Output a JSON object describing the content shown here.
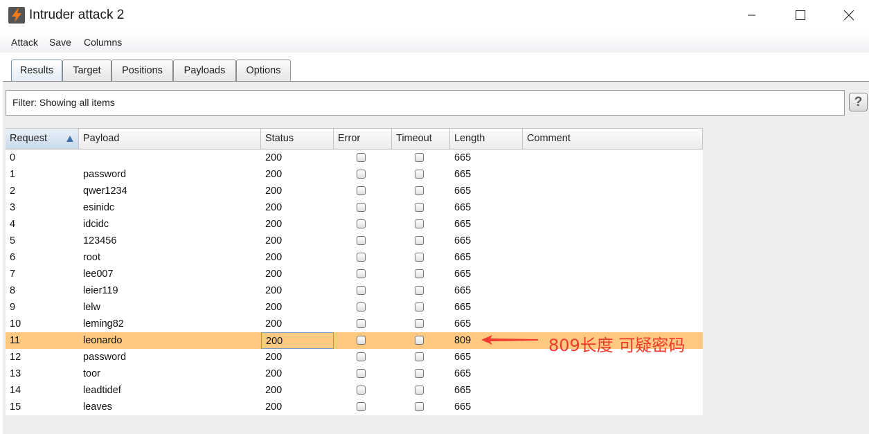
{
  "window": {
    "title": "Intruder attack 2",
    "minimize_glyph": "—",
    "maximize_glyph": "☐",
    "close_glyph": "✕"
  },
  "menu": [
    "Attack",
    "Save",
    "Columns"
  ],
  "tabs": [
    {
      "label": "Results",
      "active": true
    },
    {
      "label": "Target",
      "active": false
    },
    {
      "label": "Positions",
      "active": false
    },
    {
      "label": "Payloads",
      "active": false
    },
    {
      "label": "Options",
      "active": false
    }
  ],
  "filter": {
    "text": "Filter:  Showing all items",
    "help": "?"
  },
  "table": {
    "columns": [
      "Request",
      "Payload",
      "Status",
      "Error",
      "Timeout",
      "Length",
      "Comment"
    ],
    "sorted_column": "Request",
    "sort_direction": "ascending",
    "rows": [
      {
        "request": "0",
        "payload": "",
        "status": "200",
        "error": false,
        "timeout": false,
        "length": "665",
        "comment": ""
      },
      {
        "request": "1",
        "payload": "password",
        "status": "200",
        "error": false,
        "timeout": false,
        "length": "665",
        "comment": ""
      },
      {
        "request": "2",
        "payload": "qwer1234",
        "status": "200",
        "error": false,
        "timeout": false,
        "length": "665",
        "comment": ""
      },
      {
        "request": "3",
        "payload": "esinidc",
        "status": "200",
        "error": false,
        "timeout": false,
        "length": "665",
        "comment": ""
      },
      {
        "request": "4",
        "payload": "idcidc",
        "status": "200",
        "error": false,
        "timeout": false,
        "length": "665",
        "comment": ""
      },
      {
        "request": "5",
        "payload": "123456",
        "status": "200",
        "error": false,
        "timeout": false,
        "length": "665",
        "comment": ""
      },
      {
        "request": "6",
        "payload": "root",
        "status": "200",
        "error": false,
        "timeout": false,
        "length": "665",
        "comment": ""
      },
      {
        "request": "7",
        "payload": "lee007",
        "status": "200",
        "error": false,
        "timeout": false,
        "length": "665",
        "comment": ""
      },
      {
        "request": "8",
        "payload": "leier119",
        "status": "200",
        "error": false,
        "timeout": false,
        "length": "665",
        "comment": ""
      },
      {
        "request": "9",
        "payload": "lelw",
        "status": "200",
        "error": false,
        "timeout": false,
        "length": "665",
        "comment": ""
      },
      {
        "request": "10",
        "payload": "leming82",
        "status": "200",
        "error": false,
        "timeout": false,
        "length": "665",
        "comment": ""
      },
      {
        "request": "11",
        "payload": "leonardo",
        "status": "200",
        "error": false,
        "timeout": false,
        "length": "809",
        "comment": "",
        "selected": true
      },
      {
        "request": "12",
        "payload": "password",
        "status": "200",
        "error": false,
        "timeout": false,
        "length": "665",
        "comment": ""
      },
      {
        "request": "13",
        "payload": "toor",
        "status": "200",
        "error": false,
        "timeout": false,
        "length": "665",
        "comment": ""
      },
      {
        "request": "14",
        "payload": "leadtidef",
        "status": "200",
        "error": false,
        "timeout": false,
        "length": "665",
        "comment": ""
      },
      {
        "request": "15",
        "payload": "leaves",
        "status": "200",
        "error": false,
        "timeout": false,
        "length": "665",
        "comment": ""
      }
    ]
  },
  "annotation": {
    "text": "809长度 可疑密码",
    "color": "#ee3b2d"
  },
  "colors": {
    "highlight_row": "#ffc982",
    "sort_arrow": "#3f6fa8",
    "app_icon_bg": "#555555",
    "app_icon_bolt": "#f07a1a"
  },
  "icons": {
    "app": "burp-lightning-icon",
    "sort": "sort-ascending-icon",
    "checkbox": "checkbox-icon"
  }
}
